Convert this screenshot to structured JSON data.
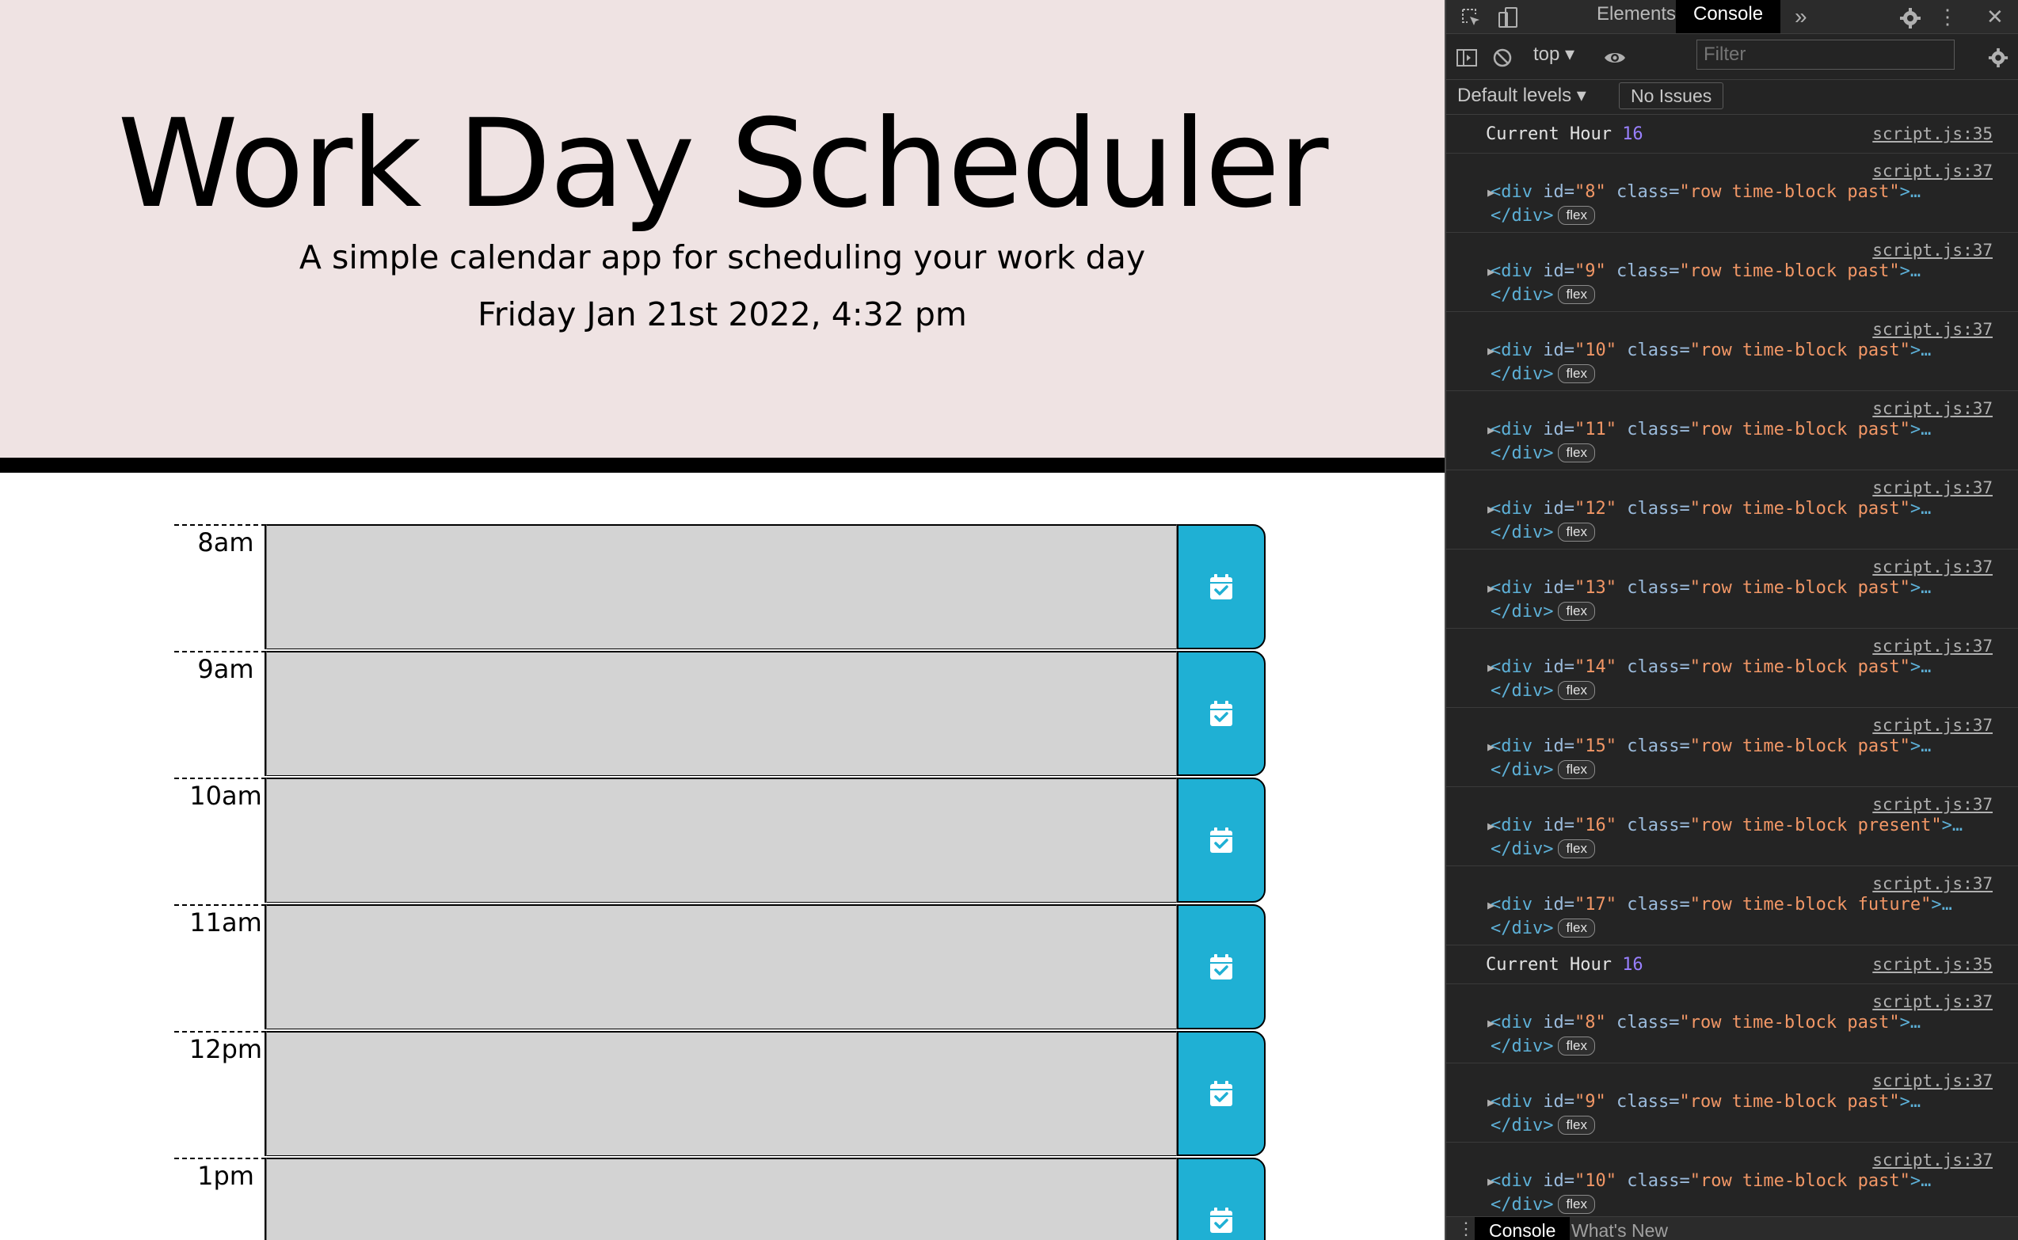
{
  "app": {
    "title": "Work Day Scheduler",
    "lead": "A simple calendar app for scheduling your work day",
    "current_date": "Friday Jan 21st 2022, 4:32 pm"
  },
  "time_blocks": [
    {
      "label": "8am",
      "state": "past"
    },
    {
      "label": "9am",
      "state": "past"
    },
    {
      "label": "10am",
      "state": "past"
    },
    {
      "label": "11am",
      "state": "past"
    },
    {
      "label": "12pm",
      "state": "past"
    },
    {
      "label": "1pm",
      "state": "past"
    }
  ],
  "colors": {
    "header_bg": "#efe3e3",
    "past": "#d3d3d3",
    "save_button": "#1fb0d4",
    "devtools_bg": "#242424"
  },
  "devtools": {
    "tabs": {
      "elements": "Elements",
      "console": "Console",
      "more": "»"
    },
    "context": "top",
    "filter_placeholder": "Filter",
    "levels": "Default levels",
    "issues": "No Issues",
    "drawer_tabs": {
      "console": "Console",
      "whats_new": "What's New"
    },
    "messages": [
      {
        "type": "log",
        "text": "Current Hour ",
        "value": "16",
        "source": "script.js:35"
      },
      {
        "type": "element",
        "id": "8",
        "cls": "row time-block past",
        "source": "script.js:37"
      },
      {
        "type": "element",
        "id": "9",
        "cls": "row time-block past",
        "source": "script.js:37"
      },
      {
        "type": "element",
        "id": "10",
        "cls": "row time-block past",
        "source": "script.js:37"
      },
      {
        "type": "element",
        "id": "11",
        "cls": "row time-block past",
        "source": "script.js:37"
      },
      {
        "type": "element",
        "id": "12",
        "cls": "row time-block past",
        "source": "script.js:37"
      },
      {
        "type": "element",
        "id": "13",
        "cls": "row time-block past",
        "source": "script.js:37"
      },
      {
        "type": "element",
        "id": "14",
        "cls": "row time-block past",
        "source": "script.js:37"
      },
      {
        "type": "element",
        "id": "15",
        "cls": "row time-block past",
        "source": "script.js:37"
      },
      {
        "type": "element",
        "id": "16",
        "cls": "row time-block present",
        "source": "script.js:37"
      },
      {
        "type": "element",
        "id": "17",
        "cls": "row time-block future",
        "source": "script.js:37"
      },
      {
        "type": "log",
        "text": "Current Hour ",
        "value": "16",
        "source": "script.js:35"
      },
      {
        "type": "element",
        "id": "8",
        "cls": "row time-block past",
        "source": "script.js:37"
      },
      {
        "type": "element",
        "id": "9",
        "cls": "row time-block past",
        "source": "script.js:37"
      },
      {
        "type": "element",
        "id": "10",
        "cls": "row time-block past",
        "source": "script.js:37"
      }
    ],
    "el_badge": "flex",
    "close_tag": "</div>"
  }
}
